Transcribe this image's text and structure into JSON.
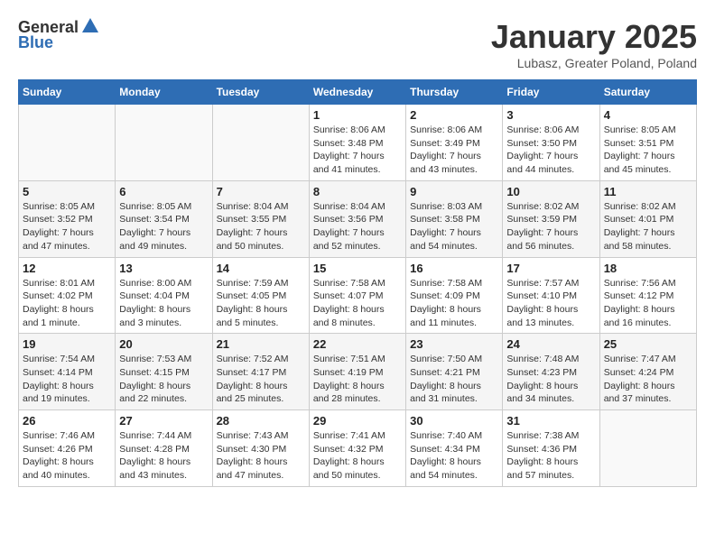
{
  "header": {
    "logo_line1": "General",
    "logo_line2": "Blue",
    "month_title": "January 2025",
    "location": "Lubasz, Greater Poland, Poland"
  },
  "weekdays": [
    "Sunday",
    "Monday",
    "Tuesday",
    "Wednesday",
    "Thursday",
    "Friday",
    "Saturday"
  ],
  "weeks": [
    [
      {
        "day": "",
        "info": ""
      },
      {
        "day": "",
        "info": ""
      },
      {
        "day": "",
        "info": ""
      },
      {
        "day": "1",
        "info": "Sunrise: 8:06 AM\nSunset: 3:48 PM\nDaylight: 7 hours\nand 41 minutes."
      },
      {
        "day": "2",
        "info": "Sunrise: 8:06 AM\nSunset: 3:49 PM\nDaylight: 7 hours\nand 43 minutes."
      },
      {
        "day": "3",
        "info": "Sunrise: 8:06 AM\nSunset: 3:50 PM\nDaylight: 7 hours\nand 44 minutes."
      },
      {
        "day": "4",
        "info": "Sunrise: 8:05 AM\nSunset: 3:51 PM\nDaylight: 7 hours\nand 45 minutes."
      }
    ],
    [
      {
        "day": "5",
        "info": "Sunrise: 8:05 AM\nSunset: 3:52 PM\nDaylight: 7 hours\nand 47 minutes."
      },
      {
        "day": "6",
        "info": "Sunrise: 8:05 AM\nSunset: 3:54 PM\nDaylight: 7 hours\nand 49 minutes."
      },
      {
        "day": "7",
        "info": "Sunrise: 8:04 AM\nSunset: 3:55 PM\nDaylight: 7 hours\nand 50 minutes."
      },
      {
        "day": "8",
        "info": "Sunrise: 8:04 AM\nSunset: 3:56 PM\nDaylight: 7 hours\nand 52 minutes."
      },
      {
        "day": "9",
        "info": "Sunrise: 8:03 AM\nSunset: 3:58 PM\nDaylight: 7 hours\nand 54 minutes."
      },
      {
        "day": "10",
        "info": "Sunrise: 8:02 AM\nSunset: 3:59 PM\nDaylight: 7 hours\nand 56 minutes."
      },
      {
        "day": "11",
        "info": "Sunrise: 8:02 AM\nSunset: 4:01 PM\nDaylight: 7 hours\nand 58 minutes."
      }
    ],
    [
      {
        "day": "12",
        "info": "Sunrise: 8:01 AM\nSunset: 4:02 PM\nDaylight: 8 hours\nand 1 minute."
      },
      {
        "day": "13",
        "info": "Sunrise: 8:00 AM\nSunset: 4:04 PM\nDaylight: 8 hours\nand 3 minutes."
      },
      {
        "day": "14",
        "info": "Sunrise: 7:59 AM\nSunset: 4:05 PM\nDaylight: 8 hours\nand 5 minutes."
      },
      {
        "day": "15",
        "info": "Sunrise: 7:58 AM\nSunset: 4:07 PM\nDaylight: 8 hours\nand 8 minutes."
      },
      {
        "day": "16",
        "info": "Sunrise: 7:58 AM\nSunset: 4:09 PM\nDaylight: 8 hours\nand 11 minutes."
      },
      {
        "day": "17",
        "info": "Sunrise: 7:57 AM\nSunset: 4:10 PM\nDaylight: 8 hours\nand 13 minutes."
      },
      {
        "day": "18",
        "info": "Sunrise: 7:56 AM\nSunset: 4:12 PM\nDaylight: 8 hours\nand 16 minutes."
      }
    ],
    [
      {
        "day": "19",
        "info": "Sunrise: 7:54 AM\nSunset: 4:14 PM\nDaylight: 8 hours\nand 19 minutes."
      },
      {
        "day": "20",
        "info": "Sunrise: 7:53 AM\nSunset: 4:15 PM\nDaylight: 8 hours\nand 22 minutes."
      },
      {
        "day": "21",
        "info": "Sunrise: 7:52 AM\nSunset: 4:17 PM\nDaylight: 8 hours\nand 25 minutes."
      },
      {
        "day": "22",
        "info": "Sunrise: 7:51 AM\nSunset: 4:19 PM\nDaylight: 8 hours\nand 28 minutes."
      },
      {
        "day": "23",
        "info": "Sunrise: 7:50 AM\nSunset: 4:21 PM\nDaylight: 8 hours\nand 31 minutes."
      },
      {
        "day": "24",
        "info": "Sunrise: 7:48 AM\nSunset: 4:23 PM\nDaylight: 8 hours\nand 34 minutes."
      },
      {
        "day": "25",
        "info": "Sunrise: 7:47 AM\nSunset: 4:24 PM\nDaylight: 8 hours\nand 37 minutes."
      }
    ],
    [
      {
        "day": "26",
        "info": "Sunrise: 7:46 AM\nSunset: 4:26 PM\nDaylight: 8 hours\nand 40 minutes."
      },
      {
        "day": "27",
        "info": "Sunrise: 7:44 AM\nSunset: 4:28 PM\nDaylight: 8 hours\nand 43 minutes."
      },
      {
        "day": "28",
        "info": "Sunrise: 7:43 AM\nSunset: 4:30 PM\nDaylight: 8 hours\nand 47 minutes."
      },
      {
        "day": "29",
        "info": "Sunrise: 7:41 AM\nSunset: 4:32 PM\nDaylight: 8 hours\nand 50 minutes."
      },
      {
        "day": "30",
        "info": "Sunrise: 7:40 AM\nSunset: 4:34 PM\nDaylight: 8 hours\nand 54 minutes."
      },
      {
        "day": "31",
        "info": "Sunrise: 7:38 AM\nSunset: 4:36 PM\nDaylight: 8 hours\nand 57 minutes."
      },
      {
        "day": "",
        "info": ""
      }
    ]
  ]
}
